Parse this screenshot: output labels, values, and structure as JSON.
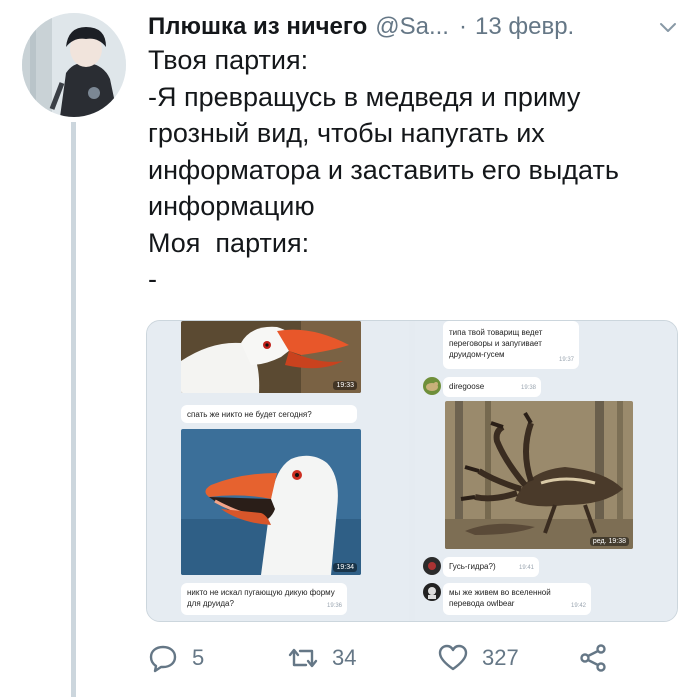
{
  "tweet": {
    "display_name": "Плюшка из ничего",
    "handle": "@Sa...",
    "separator": "·",
    "date": "13 февр.",
    "text_lines": [
      "Твоя партия:",
      "-Я превращусь в медведя и приму",
      "грозный вид, чтобы напугать их",
      "информатора и заставить его выдать",
      "информацию",
      "Моя  партия:",
      "-"
    ]
  },
  "chat_left": {
    "photo1_time": "19:33",
    "msg1": "спать же никто не будет сегодня?",
    "photo2_time": "19:34",
    "msg2": "никто не искал пугающую дикую форму для друида?",
    "msg2_time": "19:36"
  },
  "chat_right": {
    "msg1": "типа твой товарищ ведет переговоры и запугивает друидом-гусем",
    "msg1_time": "19:37",
    "user1": "diregoose",
    "user1_time": "19:38",
    "image_caption": "ред. 19:38",
    "msg2": "Гусь-гидра?)",
    "msg2_time": "19:41",
    "msg3": "мы же живем во вселенной перевода owlbear",
    "msg3_time": "19:42"
  },
  "actions": {
    "replies": "5",
    "retweets": "34",
    "likes": "327"
  },
  "colors": {
    "text": "#14171a",
    "muted": "#657786",
    "thread_line": "#ccd6dd"
  }
}
